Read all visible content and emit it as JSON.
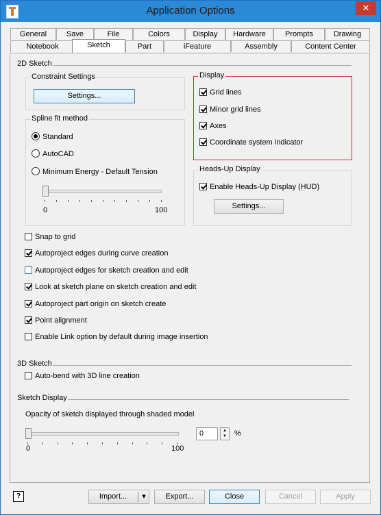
{
  "window": {
    "title": "Application Options",
    "close_glyph": "✕"
  },
  "tabs_row1": [
    "General",
    "Save",
    "File",
    "Colors",
    "Display",
    "Hardware",
    "Prompts",
    "Drawing"
  ],
  "tabs_row2": [
    "Notebook",
    "Sketch",
    "Part",
    "iFeature",
    "Assembly",
    "Content Center"
  ],
  "active_tab": "Sketch",
  "sketch2d": {
    "heading": "2D Sketch",
    "constraint_settings": {
      "title": "Constraint Settings",
      "button": "Settings..."
    },
    "spline": {
      "title": "Spline fit method",
      "options": [
        "Standard",
        "AutoCAD",
        "Minimum Energy - Default Tension"
      ],
      "selected": "Standard",
      "slider_min": "0",
      "slider_max": "100",
      "slider_value": 0
    },
    "display": {
      "title": "Display",
      "items": [
        {
          "label": "Grid lines",
          "checked": true
        },
        {
          "label": "Minor grid lines",
          "checked": true
        },
        {
          "label": "Axes",
          "checked": true
        },
        {
          "label": "Coordinate system indicator",
          "checked": true
        }
      ]
    },
    "hud": {
      "title": "Heads-Up Display",
      "enable_label": "Enable Heads-Up Display (HUD)",
      "enabled": true,
      "button": "Settings..."
    },
    "options": [
      {
        "label": "Snap to grid",
        "checked": false
      },
      {
        "label": "Autoproject edges during curve creation",
        "checked": true
      },
      {
        "label": "Autoproject edges for sketch creation and edit",
        "checked": false
      },
      {
        "label": "Look at sketch plane on sketch creation and edit",
        "checked": true
      },
      {
        "label": "Autoproject part origin on sketch create",
        "checked": true
      },
      {
        "label": "Point alignment",
        "checked": true
      },
      {
        "label": "Enable Link option by default during image insertion",
        "checked": false
      }
    ]
  },
  "sketch3d": {
    "heading": "3D Sketch",
    "autobend_label": "Auto-bend with 3D line creation",
    "autobend_checked": false
  },
  "sketch_display": {
    "heading": "Sketch Display",
    "opacity_label": "Opacity of sketch displayed through shaded model",
    "slider_min": "0",
    "slider_max": "100",
    "slider_value": 0,
    "spin_value": "0",
    "unit": "%"
  },
  "footer": {
    "help_glyph": "?",
    "import": "Import...",
    "dropdown_glyph": "▾",
    "export": "Export...",
    "close": "Close",
    "cancel": "Cancel",
    "apply": "Apply"
  }
}
